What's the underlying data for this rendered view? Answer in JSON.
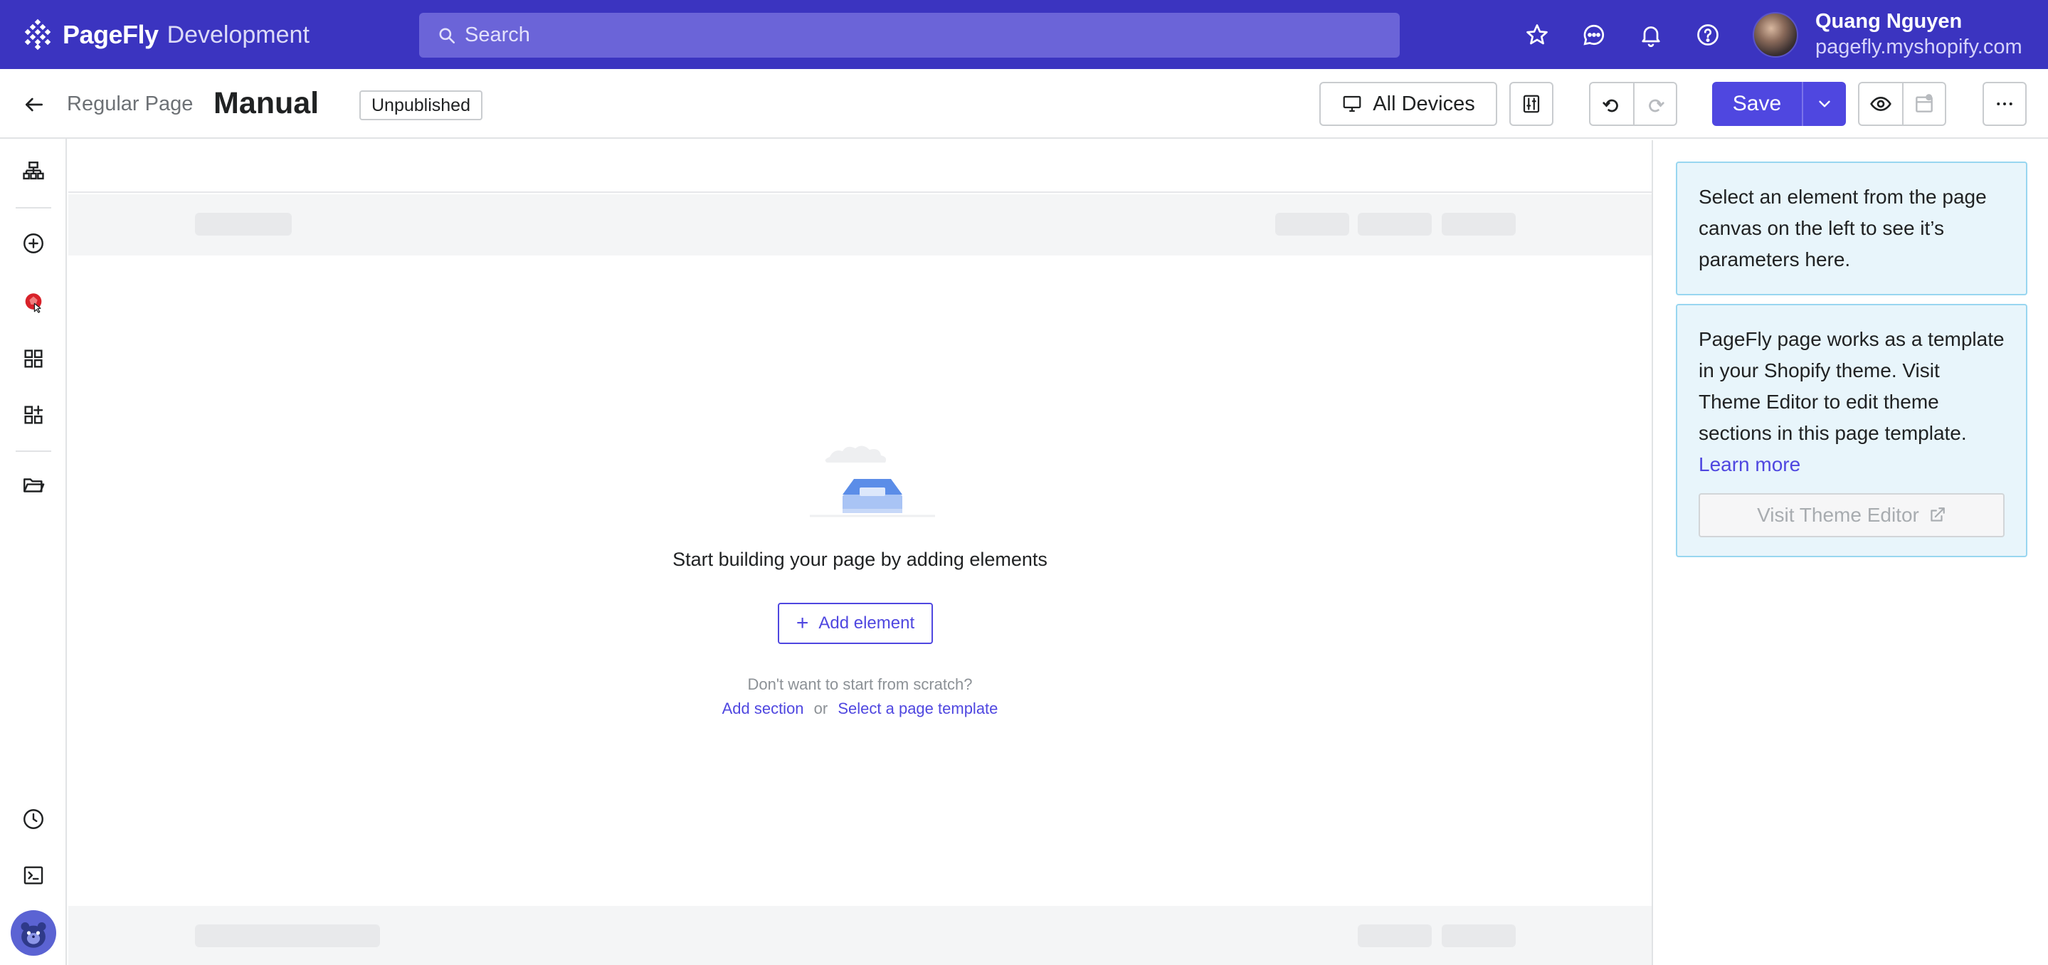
{
  "brand": {
    "name": "PageFly",
    "subtitle": "Development"
  },
  "search": {
    "placeholder": "Search"
  },
  "user": {
    "name": "Quang Nguyen",
    "store": "pagefly.myshopify.com"
  },
  "header": {
    "page_type": "Regular Page",
    "page_name": "Manual",
    "status": "Unpublished",
    "devices_label": "All Devices",
    "save_label": "Save"
  },
  "canvas": {
    "empty_title": "Start building your page by adding elements",
    "add_element_label": "Add element",
    "scratch_text": "Don't want to start from scratch?",
    "add_section_link": "Add section",
    "or_text": "or",
    "template_link": "Select a page template"
  },
  "panel": {
    "select_hint": "Select an element from the page canvas on the left to see it’s parameters here.",
    "theme_info": "PageFly page works as a template in your Shopify theme. Visit Theme Editor to edit theme sections in this page template.",
    "learn_more": "Learn more",
    "theme_editor_label": "Visit Theme Editor"
  },
  "colors": {
    "topbar": "#3b34c0",
    "accent": "#4f47e0",
    "info_bg": "#e8f5fb",
    "info_border": "#98d6f0"
  },
  "icons": {
    "topbar": [
      "star-icon",
      "chat-icon",
      "bell-icon",
      "help-icon"
    ],
    "rail": [
      "layers-icon",
      "add-circle-icon",
      "badge-icon",
      "grid-icon",
      "add-apps-icon",
      "folder-icon",
      "clock-icon",
      "terminal-icon"
    ]
  }
}
